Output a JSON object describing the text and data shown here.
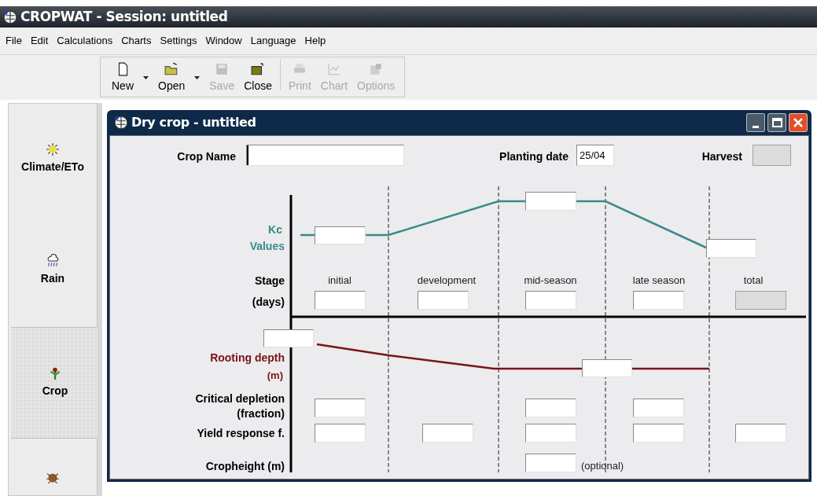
{
  "app_window": {
    "title": "CROPWAT - Session: untitled"
  },
  "menu": [
    "File",
    "Edit",
    "Calculations",
    "Charts",
    "Settings",
    "Window",
    "Language",
    "Help"
  ],
  "toolbar": [
    {
      "kind": "new",
      "label": "New",
      "disabled": false,
      "dropdown": true
    },
    {
      "kind": "open",
      "label": "Open",
      "disabled": false,
      "dropdown": true
    },
    {
      "kind": "save",
      "label": "Save",
      "disabled": true,
      "dropdown": false
    },
    {
      "kind": "close",
      "label": "Close",
      "disabled": false,
      "dropdown": false
    },
    {
      "kind": "print",
      "label": "Print",
      "disabled": true,
      "dropdown": false
    },
    {
      "kind": "chart",
      "label": "Chart",
      "disabled": true,
      "dropdown": false
    },
    {
      "kind": "options",
      "label": "Options",
      "disabled": true,
      "dropdown": false
    }
  ],
  "sidebar": {
    "items": [
      {
        "kind": "sun",
        "label": "Climate/ETo",
        "selected": false
      },
      {
        "kind": "rain",
        "label": "Rain",
        "selected": false
      },
      {
        "kind": "crop",
        "label": "Crop",
        "selected": true
      },
      {
        "kind": "soil",
        "selected": false
      }
    ]
  },
  "child_window": {
    "title": "Dry crop - untitled",
    "crop_name": {
      "label": "Crop Name",
      "focused": true
    },
    "planting_date": {
      "label": "Planting date",
      "value": "25/04"
    },
    "harvest": {
      "label": "Harvest",
      "disabled": true
    },
    "stages": [
      "initial",
      "development",
      "mid-season",
      "late season",
      "total"
    ],
    "kc": {
      "label": "Kc",
      "label_2": "Values",
      "color": "#3a8a8a"
    },
    "rooting": {
      "label": "Rooting depth",
      "label_2": "(m)",
      "color": "#7a1414"
    },
    "rows": [
      {
        "label": "Stage",
        "label_2": "(days)",
        "cells": [
          {
            "kind": "field",
            "disabled": false
          },
          {
            "kind": "field",
            "disabled": false
          },
          {
            "kind": "field",
            "disabled": false
          },
          {
            "kind": "field",
            "disabled": false
          },
          {
            "kind": "field",
            "disabled": true
          }
        ]
      },
      {
        "label": "Critical depletion",
        "label_2": "(fraction)",
        "cells": [
          {
            "kind": "field",
            "disabled": false
          },
          {
            "kind": "empty"
          },
          {
            "kind": "field",
            "disabled": false
          },
          {
            "kind": "field",
            "disabled": false
          },
          {
            "kind": "empty"
          }
        ]
      },
      {
        "label": "Yield response f.",
        "cells": [
          {
            "kind": "field",
            "disabled": false
          },
          {
            "kind": "field",
            "disabled": false
          },
          {
            "kind": "field",
            "disabled": false
          },
          {
            "kind": "field",
            "disabled": false
          },
          {
            "kind": "field",
            "disabled": false
          }
        ]
      },
      {
        "label": "Cropheight (m)",
        "note": "(optional)",
        "cells": [
          {
            "kind": "empty"
          },
          {
            "kind": "empty"
          },
          {
            "kind": "field",
            "disabled": false
          },
          {
            "kind": "empty"
          },
          {
            "kind": "empty"
          }
        ]
      }
    ]
  }
}
